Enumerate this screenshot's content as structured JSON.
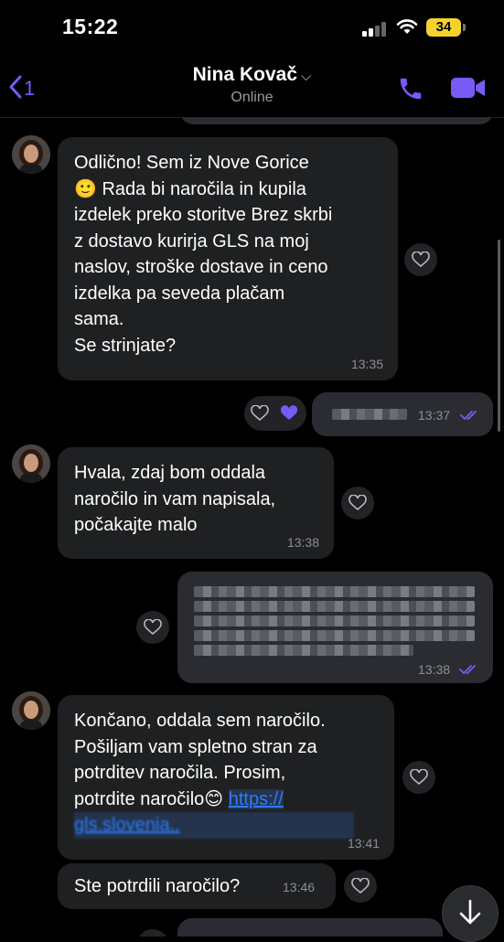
{
  "status_bar": {
    "time": "15:22",
    "battery": "34"
  },
  "header": {
    "back_count": "1",
    "contact_name": "Nina Kovač",
    "chevron": "⌵",
    "status": "Online"
  },
  "messages": [
    {
      "dir": "in",
      "text": "Odlično! Sem iz Nove Gorice\n🙂 Rada bi naročila in kupila\nizdelek preko storitve Brez skrbi\nz dostavo kurirja GLS na moj\nnaslov, stroške dostave in ceno\nizdelka pa seveda plačam\nsama.\nSe strinjate?",
      "time": "13:35"
    },
    {
      "dir": "out",
      "text": "(blurred)",
      "time": "13:37"
    },
    {
      "dir": "in",
      "text": "Hvala, zdaj bom oddala\nnaročilo in vam napisala,\npočakajte malo",
      "time": "13:38"
    },
    {
      "dir": "out",
      "text": "(blurred)",
      "time": "13:38"
    },
    {
      "dir": "in",
      "text_before": "Končano, oddala sem naročilo.\nPošiljam vam spletno stran za\npotrditev naročila. Prosim,\npotrdite naročilo😊 ",
      "link_line1": "https://",
      "link_line2": "gls.slovenia..",
      "time": "13:41"
    },
    {
      "dir": "in",
      "text": "Ste potrdili naročilo?",
      "time": "13:46"
    }
  ],
  "icons": {
    "back": "back-chevron-icon",
    "call": "phone-icon",
    "video": "video-camera-icon",
    "like": "heart-icon",
    "read": "double-check-icon",
    "scroll": "arrow-down-icon"
  },
  "colors": {
    "accent": "#7a5af5",
    "incoming_bubble": "#1f2022",
    "outgoing_bubble": "#2b2c31",
    "link": "#2e7bff"
  }
}
